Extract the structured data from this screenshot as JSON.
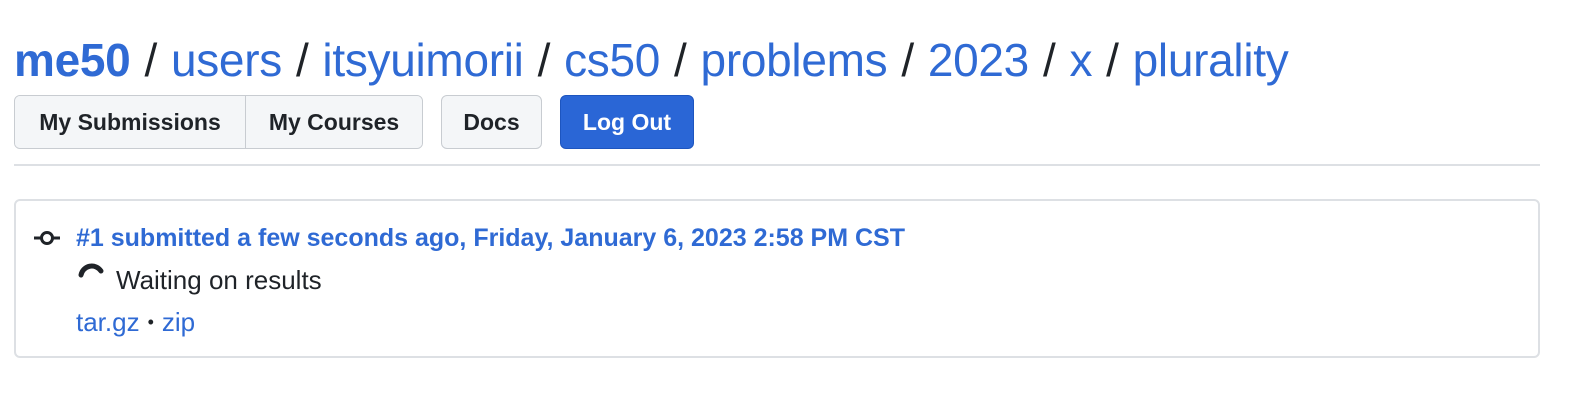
{
  "breadcrumb": {
    "root": "me50",
    "items": [
      "users",
      "itsyuimorii",
      "cs50",
      "problems",
      "2023",
      "x",
      "plurality"
    ],
    "separator": "/"
  },
  "nav": {
    "my_submissions": "My Submissions",
    "my_courses": "My Courses",
    "docs": "Docs",
    "log_out": "Log Out"
  },
  "submission": {
    "title": "#1 submitted a few seconds ago, Friday, January 6, 2023 2:58 PM CST",
    "status": "Waiting on results",
    "downloads": {
      "targz": "tar.gz",
      "separator": "•",
      "zip": "zip"
    }
  },
  "icons": {
    "commit": "git-commit-icon",
    "status": "spinner-icon"
  },
  "colors": {
    "link": "#2f6ad4",
    "primary_button": "#2a66d6",
    "border": "#dde0e4"
  }
}
